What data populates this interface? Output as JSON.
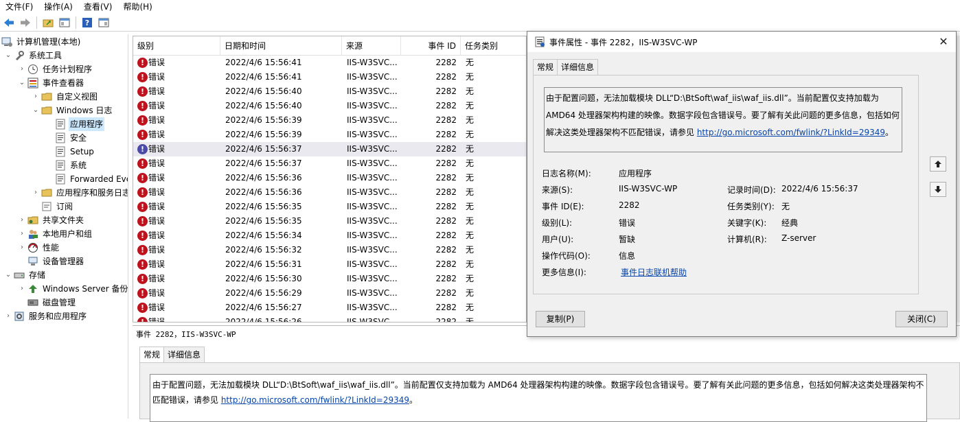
{
  "menu": [
    "文件(F)",
    "操作(A)",
    "查看(V)",
    "帮助(H)"
  ],
  "tree": {
    "items": [
      {
        "label": "计算机管理(本地)",
        "level": 0,
        "expanded": null,
        "icon": "computer-mgmt-icon"
      },
      {
        "label": "系统工具",
        "level": 1,
        "expanded": true,
        "icon": "tools-icon"
      },
      {
        "label": "任务计划程序",
        "level": 2,
        "expanded": false,
        "icon": "clock-icon"
      },
      {
        "label": "事件查看器",
        "level": 2,
        "expanded": true,
        "icon": "event-viewer-icon"
      },
      {
        "label": "自定义视图",
        "level": 3,
        "expanded": false,
        "icon": "folder-icon"
      },
      {
        "label": "Windows 日志",
        "level": 3,
        "expanded": true,
        "icon": "folder-icon"
      },
      {
        "label": "应用程序",
        "level": 4,
        "expanded": null,
        "icon": "log-icon",
        "selected": true
      },
      {
        "label": "安全",
        "level": 4,
        "expanded": null,
        "icon": "log-icon"
      },
      {
        "label": "Setup",
        "level": 4,
        "expanded": null,
        "icon": "log-icon"
      },
      {
        "label": "系统",
        "level": 4,
        "expanded": null,
        "icon": "log-icon"
      },
      {
        "label": "Forwarded Eve",
        "level": 4,
        "expanded": null,
        "icon": "log-icon"
      },
      {
        "label": "应用程序和服务日志",
        "level": 3,
        "expanded": false,
        "icon": "folder-icon"
      },
      {
        "label": "订阅",
        "level": 3,
        "expanded": null,
        "icon": "subscription-icon"
      },
      {
        "label": "共享文件夹",
        "level": 2,
        "expanded": false,
        "icon": "shared-folder-icon"
      },
      {
        "label": "本地用户和组",
        "level": 2,
        "expanded": false,
        "icon": "users-icon"
      },
      {
        "label": "性能",
        "level": 2,
        "expanded": false,
        "icon": "performance-icon"
      },
      {
        "label": "设备管理器",
        "level": 2,
        "expanded": null,
        "icon": "device-icon"
      },
      {
        "label": "存储",
        "level": 1,
        "expanded": true,
        "icon": "storage-icon"
      },
      {
        "label": "Windows Server 备份",
        "level": 2,
        "expanded": false,
        "icon": "backup-icon"
      },
      {
        "label": "磁盘管理",
        "level": 2,
        "expanded": null,
        "icon": "disk-icon"
      },
      {
        "label": "服务和应用程序",
        "level": 1,
        "expanded": false,
        "icon": "services-icon"
      }
    ]
  },
  "list": {
    "headers": [
      "级别",
      "日期和时间",
      "来源",
      "事件 ID",
      "任务类别"
    ],
    "rows": [
      [
        "错误",
        "2022/4/6 15:56:41",
        "IIS-W3SVC...",
        "2282",
        "无"
      ],
      [
        "错误",
        "2022/4/6 15:56:41",
        "IIS-W3SVC...",
        "2282",
        "无"
      ],
      [
        "错误",
        "2022/4/6 15:56:40",
        "IIS-W3SVC...",
        "2282",
        "无"
      ],
      [
        "错误",
        "2022/4/6 15:56:40",
        "IIS-W3SVC...",
        "2282",
        "无"
      ],
      [
        "错误",
        "2022/4/6 15:56:39",
        "IIS-W3SVC...",
        "2282",
        "无"
      ],
      [
        "错误",
        "2022/4/6 15:56:39",
        "IIS-W3SVC...",
        "2282",
        "无"
      ],
      [
        "错误",
        "2022/4/6 15:56:37",
        "IIS-W3SVC...",
        "2282",
        "无"
      ],
      [
        "错误",
        "2022/4/6 15:56:37",
        "IIS-W3SVC...",
        "2282",
        "无"
      ],
      [
        "错误",
        "2022/4/6 15:56:36",
        "IIS-W3SVC...",
        "2282",
        "无"
      ],
      [
        "错误",
        "2022/4/6 15:56:36",
        "IIS-W3SVC...",
        "2282",
        "无"
      ],
      [
        "错误",
        "2022/4/6 15:56:35",
        "IIS-W3SVC...",
        "2282",
        "无"
      ],
      [
        "错误",
        "2022/4/6 15:56:35",
        "IIS-W3SVC...",
        "2282",
        "无"
      ],
      [
        "错误",
        "2022/4/6 15:56:34",
        "IIS-W3SVC...",
        "2282",
        "无"
      ],
      [
        "错误",
        "2022/4/6 15:56:32",
        "IIS-W3SVC...",
        "2282",
        "无"
      ],
      [
        "错误",
        "2022/4/6 15:56:31",
        "IIS-W3SVC...",
        "2282",
        "无"
      ],
      [
        "错误",
        "2022/4/6 15:56:30",
        "IIS-W3SVC...",
        "2282",
        "无"
      ],
      [
        "错误",
        "2022/4/6 15:56:29",
        "IIS-W3SVC...",
        "2282",
        "无"
      ],
      [
        "错误",
        "2022/4/6 15:56:27",
        "IIS-W3SVC...",
        "2282",
        "无"
      ],
      [
        "错误",
        "2022/4/6 15:56:26",
        "IIS-W3SVC...",
        "2282",
        "无"
      ]
    ],
    "selected_row": 6
  },
  "preview": {
    "title": "事件 2282，IIS-W3SVC-WP",
    "tabs": [
      "常规",
      "详细信息"
    ],
    "desc_text": "由于配置问题，无法加载模块 DLL“D:\\BtSoft\\waf_iis\\waf_iis.dll”。当前配置仅支持加载为 AMD64 处理器架构构建的映像。数据字段包含错误号。要了解有关此问题的更多信息，包括如何解决这类处理器架构不匹配错误，请参见 ",
    "desc_link": "http://go.microsoft.com/fwlink/?LinkId=29349",
    "desc_end": "。"
  },
  "dialog": {
    "title": "事件属性 - 事件 2282，IIS-W3SVC-WP",
    "tabs": [
      "常规",
      "详细信息"
    ],
    "desc_text": "由于配置问题，无法加载模块 DLL“D:\\BtSoft\\waf_iis\\waf_iis.dll”。当前配置仅支持加载为 AMD64 处理器架构构建的映像。数据字段包含错误号。要了解有关此问题的更多信息，包括如何解决这类处理器架构不匹配错误，请参见 ",
    "desc_link": "http://go.microsoft.com/fwlink/?LinkId=29349",
    "desc_end": "。",
    "fields": {
      "log_name_label": "日志名称(M):",
      "log_name": "应用程序",
      "source_label": "来源(S):",
      "source": "IIS-W3SVC-WP",
      "logged_label": "记录时间(D):",
      "logged": "2022/4/6 15:56:37",
      "event_id_label": "事件 ID(E):",
      "event_id": "2282",
      "task_label": "任务类别(Y):",
      "task": "无",
      "level_label": "级别(L):",
      "level": "错误",
      "keywords_label": "关键字(K):",
      "keywords": "经典",
      "user_label": "用户(U):",
      "user": "暂缺",
      "computer_label": "计算机(R):",
      "computer": "Z-server",
      "opcode_label": "操作代码(O):",
      "opcode": "信息",
      "more_info_label": "更多信息(I):",
      "more_info": "事件日志联机帮助"
    },
    "copy_button": "复制(P)",
    "close_button": "关闭(C)"
  }
}
